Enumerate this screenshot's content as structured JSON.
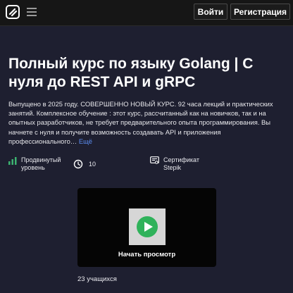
{
  "header": {
    "logo_icon": "stepik-logo-icon",
    "menu_icon": "hamburger-menu-icon",
    "login_label": "Войти",
    "register_label": "Регистрация"
  },
  "course": {
    "title": "Полный курс по языку Golang | С нуля до REST API и gRPC",
    "description": "Выпущено в 2025 году. СОВЕРШЕННО НОВЫЙ КУРС. 92 часа лекций и практических занятий. Комплексное обучение : этот курс, рассчитанный как на новичков, так и на опытных разработчиков, не требует предварительного опыта программирования. Вы начнете с нуля и получите возможность создавать API и приложения профессионального…",
    "more_label": "Ещё",
    "level_line1": "Продвинутый",
    "level_line2": "уровень",
    "hours": "10",
    "certificate_line1": "Сертификат",
    "certificate_line2": "Stepik",
    "preview_label": "Начать просмотр",
    "students": "23 учащихся"
  },
  "colors": {
    "background": "#1e1f30",
    "topbar": "#161616",
    "link": "#5b8cf0",
    "play": "#2fb25a",
    "level_bars": "#3cb371"
  }
}
